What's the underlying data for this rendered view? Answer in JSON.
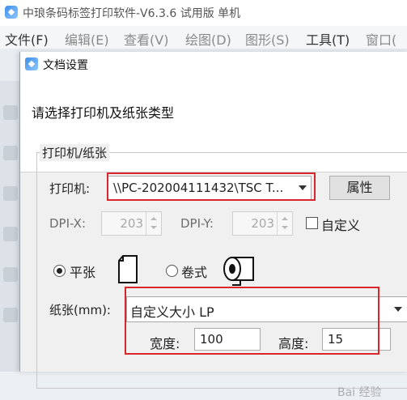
{
  "app": {
    "title": "中琅条码标签打印软件-V6.3.6 试用版 单机"
  },
  "menu": [
    {
      "label": "文件(F)",
      "enabled": true
    },
    {
      "label": "编辑(E)",
      "enabled": false
    },
    {
      "label": "查看(V)",
      "enabled": false
    },
    {
      "label": "绘图(D)",
      "enabled": false
    },
    {
      "label": "图形(S)",
      "enabled": false
    },
    {
      "label": "工具(T)",
      "enabled": true
    },
    {
      "label": "窗口(",
      "enabled": false
    }
  ],
  "dialog": {
    "title": "文档设置",
    "instruction": "请选择打印机及纸张类型",
    "group_label": "打印机/纸张",
    "printer_label": "打印机:",
    "printer_value": "\\\\PC-202004111432\\TSC T...",
    "properties_button": "属性",
    "dpi_x_label": "DPI-X:",
    "dpi_x_value": "203",
    "dpi_y_label": "DPI-Y:",
    "dpi_y_value": "203",
    "custom_label": "自定义",
    "custom_checked": false,
    "flat_label": "平张",
    "roll_label": "卷式",
    "paper_type_selected": "flat",
    "paper_label": "纸张(mm):",
    "paper_value": "自定义大小 LP",
    "width_label": "宽度:",
    "width_value": "100",
    "height_label": "高度:",
    "height_value": "15"
  },
  "watermark": "Bai 经验"
}
